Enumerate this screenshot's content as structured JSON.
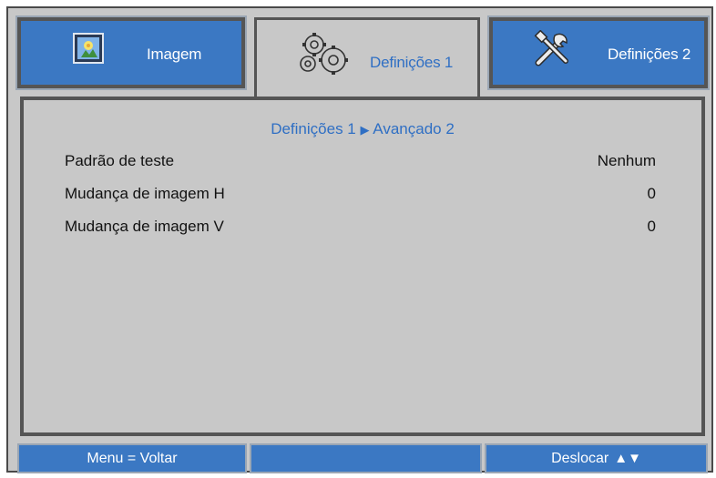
{
  "tabs": [
    {
      "label": "Imagem",
      "icon": "image-icon",
      "active": false
    },
    {
      "label": "Definições 1",
      "icon": "gears-icon",
      "active": true
    },
    {
      "label": "Definições 2",
      "icon": "tools-icon",
      "active": false
    }
  ],
  "breadcrumb": {
    "parent": "Definições 1",
    "separator": "▶",
    "current": "Avançado 2"
  },
  "rows": [
    {
      "label": "Padrão de teste",
      "value": "Nenhum"
    },
    {
      "label": "Mudança de imagem H",
      "value": "0"
    },
    {
      "label": "Mudança de imagem V",
      "value": "0"
    }
  ],
  "footer": {
    "left": "Menu = Voltar",
    "middle": "",
    "right": "Deslocar",
    "right_arrows": "▲▼"
  },
  "colors": {
    "accent": "#3b78c3",
    "panel": "#c8c8c8",
    "active_text": "#2f6fc4"
  }
}
